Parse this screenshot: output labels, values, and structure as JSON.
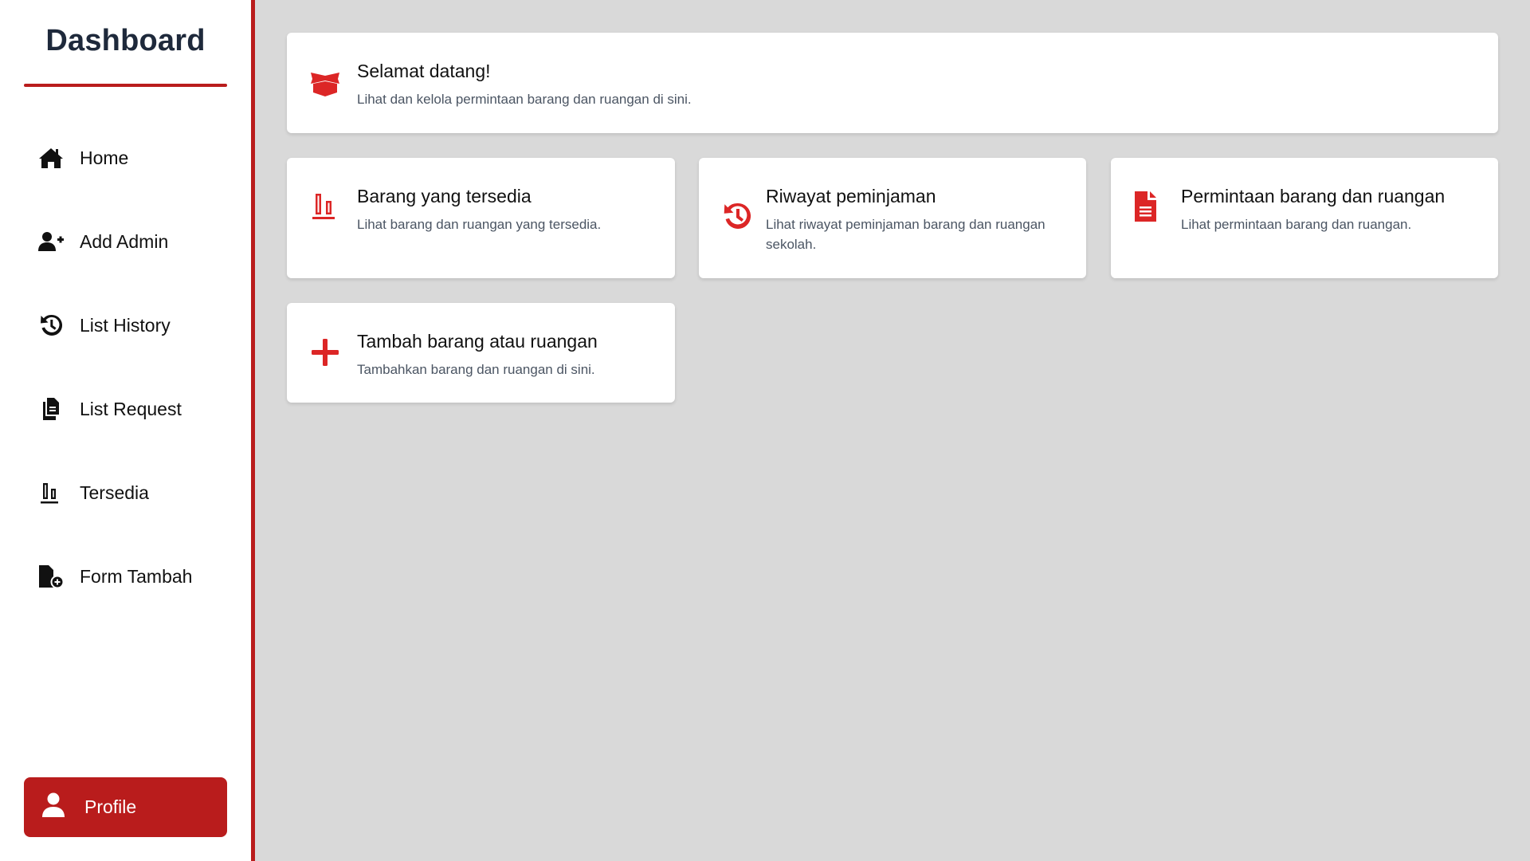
{
  "sidebar": {
    "brand": "Dashboard",
    "items": [
      {
        "label": "Home",
        "icon": "home-icon"
      },
      {
        "label": "Add Admin",
        "icon": "user-plus-icon"
      },
      {
        "label": "List History",
        "icon": "history-icon"
      },
      {
        "label": "List Request",
        "icon": "copy-icon"
      },
      {
        "label": "Tersedia",
        "icon": "chart-bars-icon"
      },
      {
        "label": "Form Tambah",
        "icon": "file-add-icon"
      }
    ],
    "profile": {
      "label": "Profile",
      "icon": "user-icon"
    }
  },
  "welcome": {
    "title": "Selamat datang!",
    "description": "Lihat dan kelola permintaan barang dan ruangan di sini.",
    "icon": "box-open-icon"
  },
  "cards": [
    {
      "title": "Barang yang tersedia",
      "description": "Lihat barang dan ruangan yang tersedia.",
      "icon": "chart-bars-icon"
    },
    {
      "title": "Riwayat peminjaman",
      "description": "Lihat riwayat peminjaman barang dan ruangan sekolah.",
      "icon": "history-icon"
    },
    {
      "title": "Permintaan barang dan ruangan",
      "description": "Lihat permintaan barang dan ruangan.",
      "icon": "file-lines-icon"
    },
    {
      "title": "Tambah barang atau ruangan",
      "description": "Tambahkan barang dan ruangan di sini.",
      "icon": "plus-icon"
    }
  ],
  "colors": {
    "accent": "#b91c1c",
    "icon_red": "#dc2626",
    "background": "#d9d9d9",
    "brand_text": "#1e293b"
  }
}
